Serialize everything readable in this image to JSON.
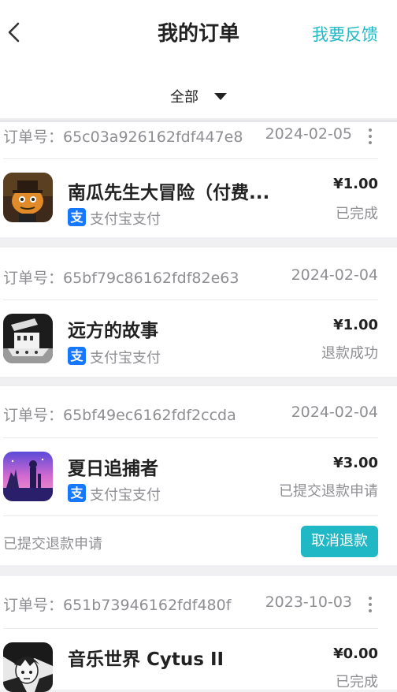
{
  "header": {
    "title": "我的订单",
    "feedback_label": "我要反馈",
    "back_icon": "chevron-left-icon"
  },
  "filter": {
    "selected": "全部"
  },
  "orders": [
    {
      "order_no": "订单号：65c03a926162fdf447e8",
      "date": "2024-02-05",
      "game_name": "南瓜先生大冒险（付费...",
      "payment": "支付宝支付",
      "price": "¥1.00",
      "status": "已完成"
    },
    {
      "order_no": "订单号：65bf79c86162fdf82e63",
      "date": "2024-02-04",
      "game_name": "远方的故事",
      "payment": "支付宝支付",
      "price": "¥1.00",
      "status": "退款成功"
    },
    {
      "order_no": "订单号：65bf49ec6162fdf2ccda",
      "date": "2024-02-04",
      "game_name": "夏日追捕者",
      "payment": "支付宝支付",
      "price": "¥3.00",
      "status": "已提交退款申请",
      "footer_text": "已提交退款申请",
      "action_label": "取消退款"
    },
    {
      "order_no": "订单号：651b73946162fdf480f",
      "date": "2023-10-03",
      "game_name": "音乐世界 Cytus II",
      "payment": "",
      "price": "¥0.00",
      "status": "已完成"
    }
  ],
  "colors": {
    "accent": "#21b8c6",
    "alipay": "#1677ff",
    "muted": "#8e8e93"
  },
  "alipay_icon_glyph": "支"
}
